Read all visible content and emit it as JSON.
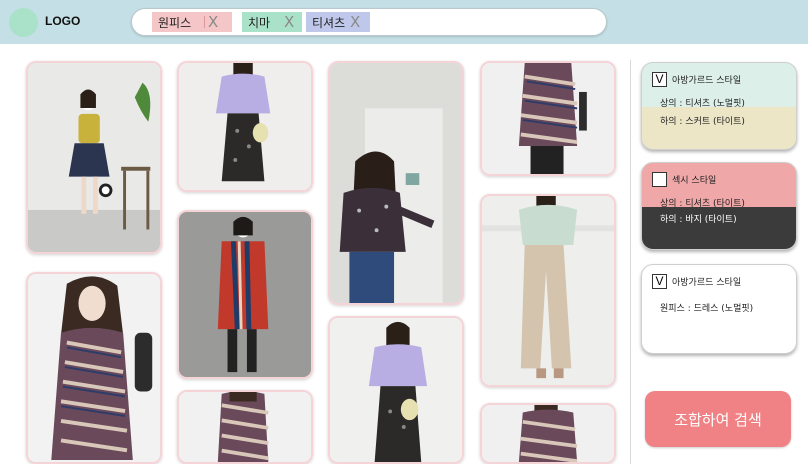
{
  "header": {
    "logo": "LOGO",
    "chips": [
      {
        "label": "원피스",
        "remove": "X"
      },
      {
        "label": "치마",
        "remove": "X"
      },
      {
        "label": "티셔츠",
        "remove": "X"
      }
    ]
  },
  "styles": [
    {
      "title": "아방가르드 스타일",
      "checked": true,
      "check_mark": "V",
      "lines": [
        "상의 : 티셔츠 (노멀핏)",
        "하의 : 스커트 (타이트)"
      ]
    },
    {
      "title": "섹시 스타일",
      "checked": false,
      "check_mark": "",
      "lines": [
        "상의 : 티셔츠 (타이트)",
        "하의 : 바지 (타이트)"
      ]
    },
    {
      "title": "아방가르드 스타일",
      "checked": true,
      "check_mark": "V",
      "lines": [
        "원피스 : 드레스 (노멀핏)"
      ]
    }
  ],
  "search_button": "조합하여 검색",
  "colors": {
    "header": "#c4dfe6",
    "accent": "#f08285",
    "chip1": "#f4c6c7",
    "chip2": "#a9e2c9",
    "chip3": "#bfc8ea"
  }
}
